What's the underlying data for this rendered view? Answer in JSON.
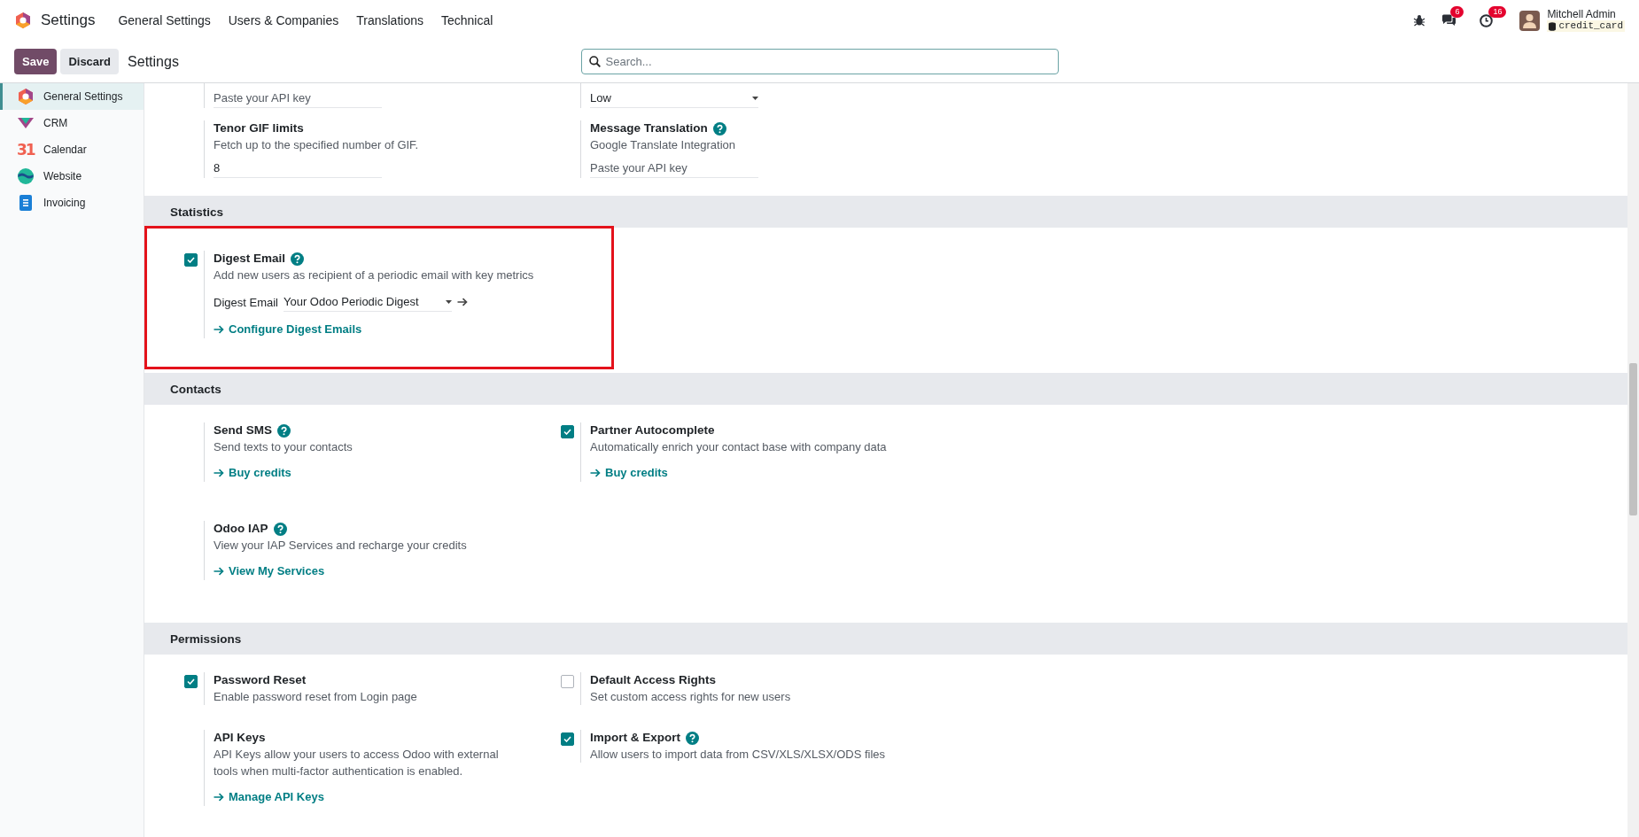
{
  "navbar": {
    "app_name": "Settings",
    "menu": [
      "General Settings",
      "Users & Companies",
      "Translations",
      "Technical"
    ],
    "systray": {
      "chat_badge": "6",
      "activity_badge": "16",
      "user_name": "Mitchell Admin",
      "database": "credit_card"
    }
  },
  "control_panel": {
    "buttons": [
      {
        "label": "Save",
        "kind": "primary"
      },
      {
        "label": "Discard",
        "kind": "secondary"
      }
    ],
    "breadcrumb": "Settings",
    "search": {
      "placeholder": "Search..."
    }
  },
  "sidebar": {
    "items": [
      {
        "label": "General Settings",
        "selected": true
      },
      {
        "label": "CRM",
        "selected": false
      },
      {
        "label": "Calendar",
        "icon_text": "31",
        "selected": false
      },
      {
        "label": "Website",
        "selected": false
      },
      {
        "label": "Invoicing",
        "selected": false
      }
    ]
  },
  "sections": [
    {
      "settings": [
        {
          "help": false,
          "highlighted": false,
          "field": {
            "kind": "text",
            "placeholder": "Paste your API key"
          }
        },
        {
          "help": false,
          "highlighted": false,
          "field": {
            "kind": "select",
            "value": "Low"
          }
        },
        {
          "title": "Tenor GIF limits",
          "help": false,
          "highlighted": false,
          "description": "Fetch up to the specified number of GIF.",
          "field": {
            "kind": "text",
            "value": "8"
          }
        },
        {
          "title": "Message Translation",
          "help": true,
          "highlighted": false,
          "description": "Google Translate Integration",
          "field": {
            "kind": "text",
            "placeholder": "Paste your API key"
          }
        }
      ]
    },
    {
      "title": "Statistics",
      "settings": [
        {
          "title": "Digest Email",
          "checked": true,
          "help": true,
          "highlighted": true,
          "description": "Add new users as recipient of a periodic email with key metrics",
          "field": {
            "kind": "many2one",
            "label": "Digest Email",
            "value": "Your Odoo Periodic Digest"
          },
          "link": "Configure Digest Emails"
        }
      ]
    },
    {
      "title": "Contacts",
      "settings": [
        {
          "title": "Send SMS",
          "help": true,
          "highlighted": false,
          "description": "Send texts to your contacts",
          "link": "Buy credits"
        },
        {
          "title": "Partner Autocomplete",
          "checked": true,
          "help": false,
          "highlighted": false,
          "description": "Automatically enrich your contact base with company data",
          "link": "Buy credits"
        },
        {
          "title": "Odoo IAP",
          "help": true,
          "highlighted": false,
          "description": "View your IAP Services and recharge your credits",
          "link": "View My Services"
        }
      ]
    },
    {
      "title": "Permissions",
      "settings": [
        {
          "title": "Password Reset",
          "checked": true,
          "help": false,
          "highlighted": false,
          "description": "Enable password reset from Login page"
        },
        {
          "title": "Default Access Rights",
          "checked": false,
          "help": false,
          "highlighted": false,
          "description": "Set custom access rights for new users"
        },
        {
          "title": "API Keys",
          "help": false,
          "highlighted": false,
          "description": "API Keys allow your users to access Odoo with external tools when multi-factor authentication is enabled.",
          "link": "Manage API Keys"
        },
        {
          "title": "Import & Export",
          "checked": true,
          "help": true,
          "highlighted": false,
          "description": "Allow users to import data from CSV/XLS/XLSX/ODS files"
        }
      ]
    }
  ]
}
